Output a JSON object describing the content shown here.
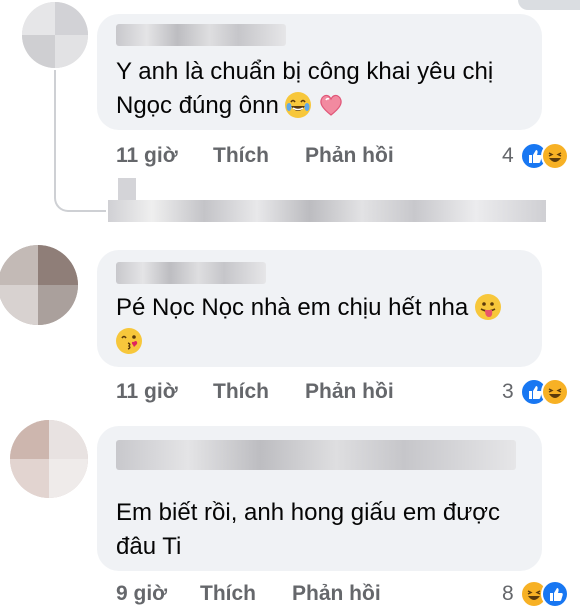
{
  "comments": [
    {
      "text_line1": "Y anh là chuẩn bị công khai yêu chị",
      "text_line2": "Ngọc đúng ônn",
      "time": "11 giờ",
      "like_label": "Thích",
      "reply_label": "Phản hồi",
      "reaction_count": "4"
    },
    {
      "text_line1": "Pé Nọc Nọc nhà em chịu hết nha",
      "text_line2": "",
      "time": "11 giờ",
      "like_label": "Thích",
      "reply_label": "Phản hồi",
      "reaction_count": "3"
    },
    {
      "text_line1": "Em biết rồi, anh hong giấu em được",
      "text_line2": "đâu Ti",
      "time": "9 giờ",
      "like_label": "Thích",
      "reply_label": "Phản hồi",
      "reaction_count": "8"
    }
  ],
  "icons": [
    "tears-of-joy-emoji",
    "heart-emoji",
    "tongue-out-emoji",
    "kiss-emoji",
    "like-reaction-icon",
    "haha-reaction-icon"
  ],
  "colors": {
    "bubble": "#f0f2f5",
    "meta": "#65676b",
    "like": "#1877f2",
    "haha": "#f7b125"
  }
}
